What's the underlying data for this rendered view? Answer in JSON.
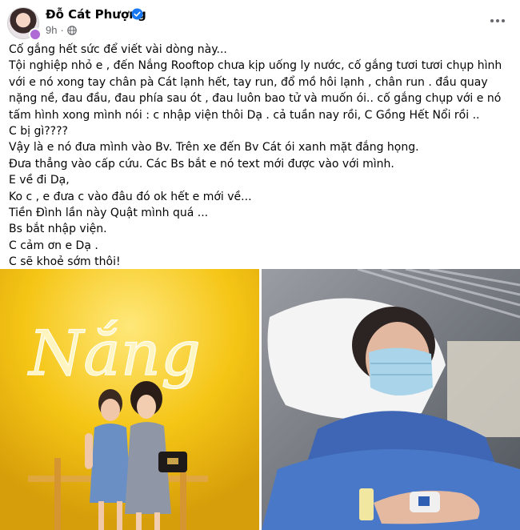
{
  "post": {
    "author": "Đỗ Cát Phượng",
    "time": "9h",
    "lines": [
      "Cố gắng hết sức để viết vài dòng này...",
      "Tội nghiệp nhỏ e , đến Nắng Rooftop chưa kịp uống ly nước, cố gắng tươi tươi chụp hình với e nó xong tay chân pà Cát lạnh hết, tay run, đổ mồ hôi lạnh , chân run . đầu quay nặng nề, đau đầu, đau phía sau ót , đau luôn bao tử và muốn ói.. cố gắng chụp với e nó tấm hình xong mình nói : c nhập viện thôi Dạ . cả tuần nay rồi,  C Gồng Hết Nổi rồi ..",
      "C bị gì????",
      "Vậy là e nó đưa mình vào Bv. Trên xe đến Bv Cát ói xanh mặt đắng họng.",
      "Đưa thẳng vào cấp cứu. Các Bs bắt e nó text mới được vào với mình.",
      "E về đi Dạ,",
      "Ko c , e đưa c vào đâu đó ok hết e mới về...",
      "Tiền Đình lần này Quật mình quá ...",
      "Bs bắt nhập viện.",
      "C cảm ơn e Dạ .",
      "C sẽ khoẻ sớm thôi!"
    ]
  },
  "media": {
    "left_sign_text": "Nắng"
  },
  "colors": {
    "verified": "#1877f2",
    "meta": "#65676b",
    "sign_glow": "#fff6c2",
    "yellow_wall": "#f3c20f",
    "mask": "#a9d4ea"
  }
}
